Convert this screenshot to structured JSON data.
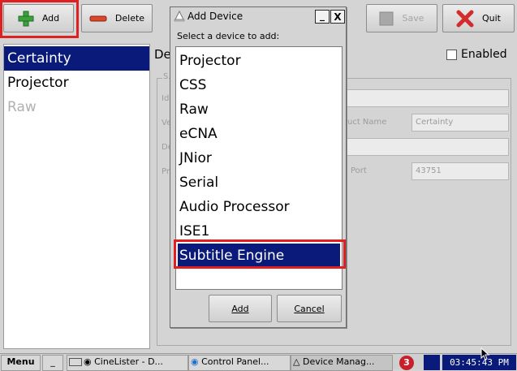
{
  "toolbar": {
    "add_label": "Add",
    "delete_label": "Delete",
    "save_label": "Save",
    "quit_label": "Quit"
  },
  "device_list": [
    {
      "label": "Certainty",
      "state": "selected"
    },
    {
      "label": "Projector",
      "state": "normal"
    },
    {
      "label": "Raw",
      "state": "disabled"
    }
  ],
  "details": {
    "heading_partial": "De",
    "enabled_label": "Enabled",
    "enabled_checked": false,
    "product_name_label": "uct Name",
    "product_name_value": "Certainty",
    "port_label": "Port",
    "port_value": "43751",
    "ghost_labels": [
      "S",
      "Id",
      "Ve",
      "De",
      "Pr"
    ]
  },
  "dialog": {
    "title": "Add Device",
    "prompt": "Select a device to add:",
    "minimize_symbol": "_",
    "close_symbol": "X",
    "items": [
      "Projector",
      "CSS",
      "Raw",
      "eCNA",
      "JNior",
      "Serial",
      "Audio Processor",
      "ISE1",
      "Subtitle Engine"
    ],
    "selected_index": 8,
    "add_button": "Add",
    "cancel_button": "Cancel"
  },
  "taskbar": {
    "menu_label": "Menu",
    "separator": "_",
    "tasks": [
      "CineLister - D...",
      "Control Panel...",
      "Device Manag..."
    ],
    "badge": "3",
    "clock": "03:45:43 PM"
  },
  "colors": {
    "selection": "#0a1a7a",
    "highlight_frame": "#e02020",
    "add_icon": "#3ca13c",
    "delete_icon": "#d9482a",
    "quit_icon": "#d22c2c",
    "clock_bg": "#0a1a7a"
  }
}
